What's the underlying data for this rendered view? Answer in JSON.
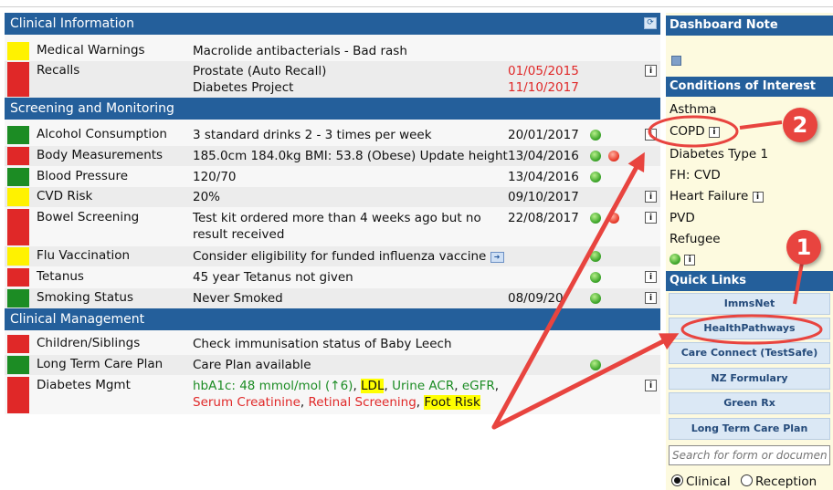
{
  "clinical_info": {
    "title": "Clinical Information",
    "rows": [
      {
        "label": "Medical Warnings",
        "value": "Macrolide antibacterials - Bad rash",
        "status": "yellow"
      },
      {
        "label": "Recalls",
        "value": "Prostate (Auto Recall)",
        "value2": "Diabetes Project",
        "date": "01/05/2015",
        "date2": "11/10/2017",
        "status": "red"
      }
    ]
  },
  "screening": {
    "title": "Screening and Monitoring",
    "rows": [
      {
        "label": "Alcohol Consumption",
        "value": "3 standard drinks 2 - 3 times per week",
        "date": "20/01/2017",
        "status": "green"
      },
      {
        "label": "Body Measurements",
        "value": "185.0cm 184.0kg BMI: 53.8 (Obese) Update height",
        "date": "13/04/2016",
        "status": "red"
      },
      {
        "label": "Blood Pressure",
        "value": "120/70",
        "date": "13/04/2016",
        "status": "green"
      },
      {
        "label": "CVD Risk",
        "value": "20%",
        "date": "09/10/2017",
        "status": "yellow"
      },
      {
        "label": "Bowel Screening",
        "value": "Test kit ordered more than 4 weeks ago but no",
        "value2": "result received",
        "date": "22/08/2017",
        "status": "red"
      },
      {
        "label": "Flu Vaccination",
        "value": "Consider eligibility for funded influenza vaccine",
        "status": "yellow"
      },
      {
        "label": "Tetanus",
        "value": "45 year Tetanus not given",
        "status": "red"
      },
      {
        "label": "Smoking Status",
        "value": "Never Smoked",
        "date": "08/09/20",
        "status": "green"
      }
    ]
  },
  "management": {
    "title": "Clinical Management",
    "rows": [
      {
        "label": "Children/Siblings",
        "value": "Check immunisation status of Baby Leech",
        "status": "red"
      },
      {
        "label": "Long Term Care Plan",
        "value": "Care Plan available",
        "status": "green"
      },
      {
        "label": "Diabetes Mgmt",
        "status": "red",
        "parts1": [
          "hbA1c: 48 mmol/mol (↑6)",
          ", ",
          "LDL",
          ", ",
          "Urine ACR",
          ", ",
          "eGFR",
          ","
        ],
        "parts2": [
          "Serum Creatinine",
          ", ",
          "Retinal Screening",
          ", ",
          "Foot Risk"
        ]
      }
    ]
  },
  "sidebar": {
    "dashboard_note": "Dashboard Note",
    "conditions_title": "Conditions of Interest",
    "conditions": [
      "Asthma",
      "COPD",
      "Diabetes Type 1",
      "FH: CVD",
      "Heart Failure",
      "PVD",
      "Refugee"
    ],
    "quick_links_title": "Quick Links",
    "quick_links": [
      "ImmsNet",
      "HealthPathways",
      "Care Connect (TestSafe)",
      "NZ Formulary",
      "Green Rx",
      "Long Term Care Plan"
    ],
    "search_placeholder": "Search for form or document",
    "radio_clinical": "Clinical",
    "radio_reception": "Reception"
  },
  "annotations": {
    "badge1": "1",
    "badge2": "2"
  },
  "colors": {
    "header": "#245f9b",
    "red": "#e02828",
    "yellow": "#fff200",
    "green": "#1c8c24",
    "annotation": "#e8443f"
  }
}
